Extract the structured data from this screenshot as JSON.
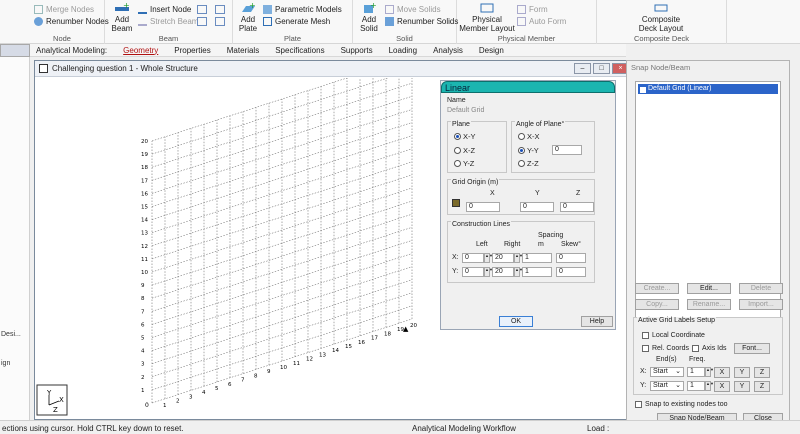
{
  "ribbon": {
    "node": {
      "name": "Node",
      "merge_nodes": "Merge Nodes",
      "renumber_nodes": "Renumber Nodes"
    },
    "beam": {
      "name": "Beam",
      "add_beam_l1": "Add",
      "add_beam_l2": "Beam",
      "insert_node": "Insert Node",
      "stretch_beam": "Stretch Beam"
    },
    "plate": {
      "name": "Plate",
      "add_plate_l1": "Add",
      "add_plate_l2": "Plate",
      "parametric_models": "Parametric Models",
      "generate_mesh": "Generate Mesh"
    },
    "solid": {
      "name": "Solid",
      "add_solid_l1": "Add",
      "add_solid_l2": "Solid",
      "move_solids": "Move Solids",
      "renumber_solids": "Renumber Solids"
    },
    "physical_member": {
      "name": "Physical Member",
      "layout_l1": "Physical",
      "layout_l2": "Member Layout",
      "form": "Form",
      "auto_form": "Auto Form"
    },
    "composite_deck": {
      "name": "Composite Deck",
      "layout_l1": "Composite",
      "layout_l2": "Deck Layout"
    }
  },
  "tabs": {
    "prefix": "Analytical Modeling:",
    "items": [
      "Geometry",
      "Properties",
      "Materials",
      "Specifications",
      "Supports",
      "Loading",
      "Analysis",
      "Design"
    ]
  },
  "left_panel": {
    "labels": [
      "Desi...",
      "ign"
    ]
  },
  "main_window": {
    "title": "Challenging question 1 - Whole Structure",
    "grid_numbers": [
      "1",
      "2",
      "3",
      "4",
      "5",
      "6",
      "7",
      "8",
      "9",
      "10",
      "11",
      "12",
      "13",
      "14",
      "15",
      "16",
      "17",
      "18",
      "19",
      "20"
    ],
    "origin_label": "0",
    "axis_y": "Y",
    "axis_x": "X",
    "axis_z": "Z"
  },
  "linear_dialog": {
    "title": "Linear",
    "name_label": "Name",
    "name_value": "Default Grid",
    "plane_label": "Plane",
    "plane_options": [
      "X-Y",
      "X-Z",
      "Y-Z"
    ],
    "angle_label": "Angle of Plane°",
    "angle_options": [
      "X-X",
      "Y-Y",
      "Z-Z"
    ],
    "angle_value": "0",
    "origin_label": "Grid Origin (m)",
    "origin_x_label": "X",
    "origin_y_label": "Y",
    "origin_z_label": "Z",
    "origin_x": "0",
    "origin_y": "0",
    "origin_z": "0",
    "construction_label": "Construction Lines",
    "left_label": "Left",
    "right_label": "Right",
    "spacing_label": "Spacing",
    "spacing_unit": "m",
    "skew_label": "Skew°",
    "row_x_label": "X:",
    "row_y_label": "Y:",
    "x_left": "0",
    "x_right": "20",
    "x_spacing": "1",
    "x_skew": "0",
    "y_left": "0",
    "y_right": "20",
    "y_spacing": "1",
    "y_skew": "0",
    "ok": "OK",
    "help": "Help"
  },
  "snap_panel": {
    "title": "Snap Node/Beam",
    "list_item": "Default Grid (Linear)",
    "create": "Create...",
    "edit": "Edit...",
    "delete": "Delete",
    "copy": "Copy...",
    "rename": "Rename...",
    "import": "Import...",
    "active_labels": "Active Grid Labels Setup",
    "local_coord": "Local Coordinate",
    "rel_coords": "Rel. Coords",
    "axis_ids": "Axis Ids",
    "font": "Font...",
    "ends_label": "End(s)",
    "freq_label": "Freq.",
    "row_x": "X:",
    "row_y": "Y:",
    "x_end": "Start",
    "x_freq": "1",
    "y_end": "Start",
    "y_freq": "1",
    "btn_x": "X",
    "btn_y": "Y",
    "btn_z": "Z",
    "snap_existing": "Snap to existing nodes too",
    "snap_button": "Snap Node/Beam",
    "close": "Close"
  },
  "status_bar": {
    "hint": "ections using cursor. Hold CTRL key down to reset.",
    "workflow": "Analytical Modeling Workflow",
    "load": "Load :"
  }
}
